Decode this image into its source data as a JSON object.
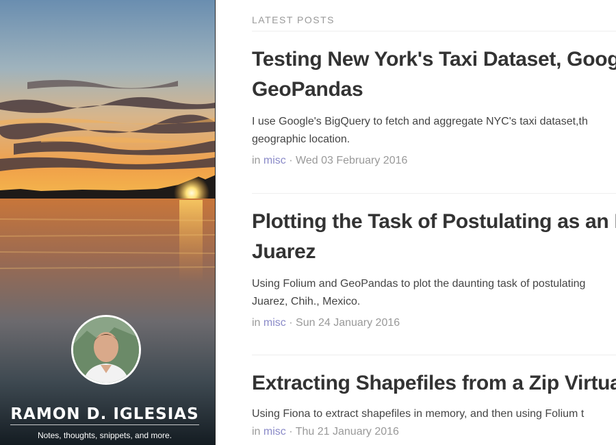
{
  "sidebar": {
    "title": "RAMON D. IGLESIAS",
    "subtitle": "Notes, thoughts, snippets, and more."
  },
  "main": {
    "section_label": "LATEST POSTS",
    "posts": [
      {
        "title_line1": "Testing New York's Taxi Dataset, Goog",
        "title_line2": "GeoPandas",
        "summary_line1": "I use Google's BigQuery to fetch and aggregate NYC's taxi dataset,th",
        "summary_line2": "geographic location.",
        "meta_prefix": "in",
        "category": "misc",
        "meta_sep": "·",
        "date": "Wed 03 February 2016"
      },
      {
        "title_line1": "Plotting the Task of Postulating as an In",
        "title_line2": "Juarez",
        "summary_line1": "Using Folium and GeoPandas to plot the daunting task of postulating",
        "summary_line2": "Juarez, Chih., Mexico.",
        "meta_prefix": "in",
        "category": "misc",
        "meta_sep": "·",
        "date": "Sun 24 January 2016"
      },
      {
        "title_line1": "Extracting Shapefiles from a Zip Virtual",
        "summary_line1": "Using Fiona to extract shapefiles in memory, and then using Folium t",
        "meta_prefix": "in",
        "category": "misc",
        "meta_sep": "·",
        "date": "Thu 21 January 2016"
      }
    ]
  }
}
